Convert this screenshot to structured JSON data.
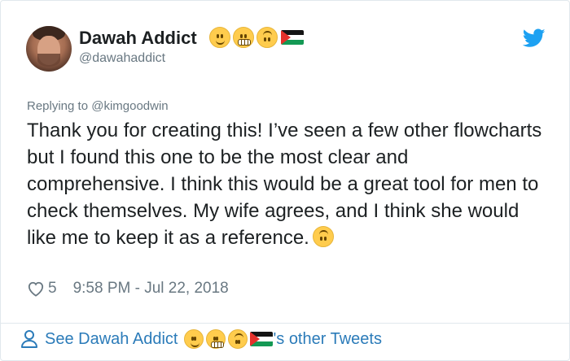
{
  "tweet": {
    "author": {
      "display_name": "Dawah Addict",
      "handle": "@dawahaddict",
      "name_emojis": [
        "slightly-smiling-face",
        "grimacing-face",
        "upside-down-face",
        "palestine-flag"
      ]
    },
    "reply_to": "Replying to @kimgoodwin",
    "text": "Thank you for creating this! I’ve seen a few other flowcharts but I found this one to be the most clear and comprehensive. I think this would be a great tool for men to check themselves. My wife agrees, and I think she would like me to keep it as a reference.",
    "text_trailing_emoji": "upside-down-face",
    "likes": "5",
    "timestamp": "9:58 PM - Jul 22, 2018"
  },
  "footer": {
    "prefix": "See Dawah Addict",
    "suffix": "'s other Tweets"
  },
  "colors": {
    "link": "#2b7bb9",
    "muted": "#697882",
    "text": "#1c2022",
    "border": "#e1e8ed",
    "twitter_blue": "#1da1f2"
  }
}
